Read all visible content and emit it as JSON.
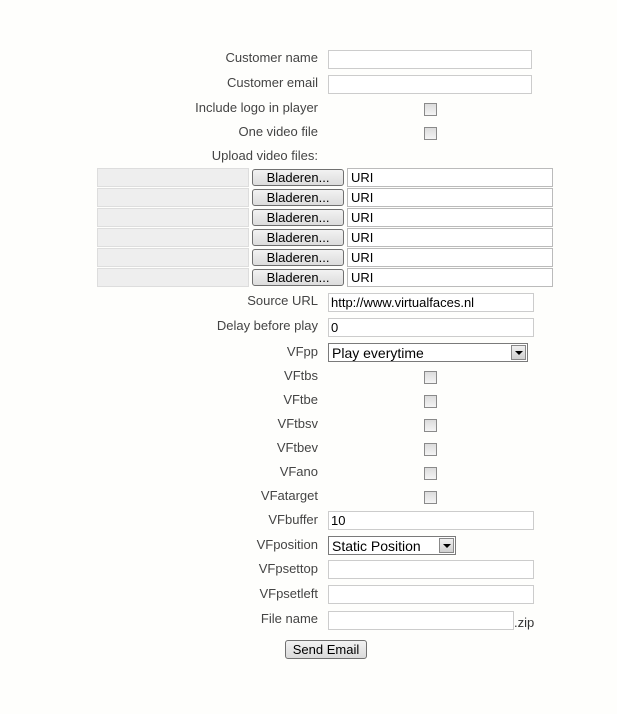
{
  "form": {
    "customer_name": {
      "label": "Customer name",
      "value": ""
    },
    "customer_email": {
      "label": "Customer email",
      "value": ""
    },
    "include_logo": {
      "label": "Include logo in player",
      "checked": false
    },
    "one_video_file": {
      "label": "One video file",
      "checked": false
    },
    "upload": {
      "label": "Upload video files:",
      "rows": [
        {
          "button": "Bladeren...",
          "uri": "URI"
        },
        {
          "button": "Bladeren...",
          "uri": "URI"
        },
        {
          "button": "Bladeren...",
          "uri": "URI"
        },
        {
          "button": "Bladeren...",
          "uri": "URI"
        },
        {
          "button": "Bladeren...",
          "uri": "URI"
        },
        {
          "button": "Bladeren...",
          "uri": "URI"
        }
      ]
    },
    "source_url": {
      "label": "Source URL",
      "value": "http://www.virtualfaces.nl"
    },
    "delay": {
      "label": "Delay before play",
      "value": "0"
    },
    "vfpp": {
      "label": "VFpp",
      "selected": "Play everytime"
    },
    "vftbs": {
      "label": "VFtbs",
      "checked": false
    },
    "vftbe": {
      "label": "VFtbe",
      "checked": false
    },
    "vftbsv": {
      "label": "VFtbsv",
      "checked": false
    },
    "vftbev": {
      "label": "VFtbev",
      "checked": false
    },
    "vfano": {
      "label": "VFano",
      "checked": false
    },
    "vfatarget": {
      "label": "VFatarget",
      "checked": false
    },
    "vfbuffer": {
      "label": "VFbuffer",
      "value": "10"
    },
    "vfposition": {
      "label": "VFposition",
      "selected": "Static Position"
    },
    "vfpsettop": {
      "label": "VFpsettop",
      "value": ""
    },
    "vfpsetleft": {
      "label": "VFpsetleft",
      "value": ""
    },
    "file_name": {
      "label": "File name",
      "value": "",
      "suffix": ".zip"
    },
    "submit_label": "Send Email"
  }
}
